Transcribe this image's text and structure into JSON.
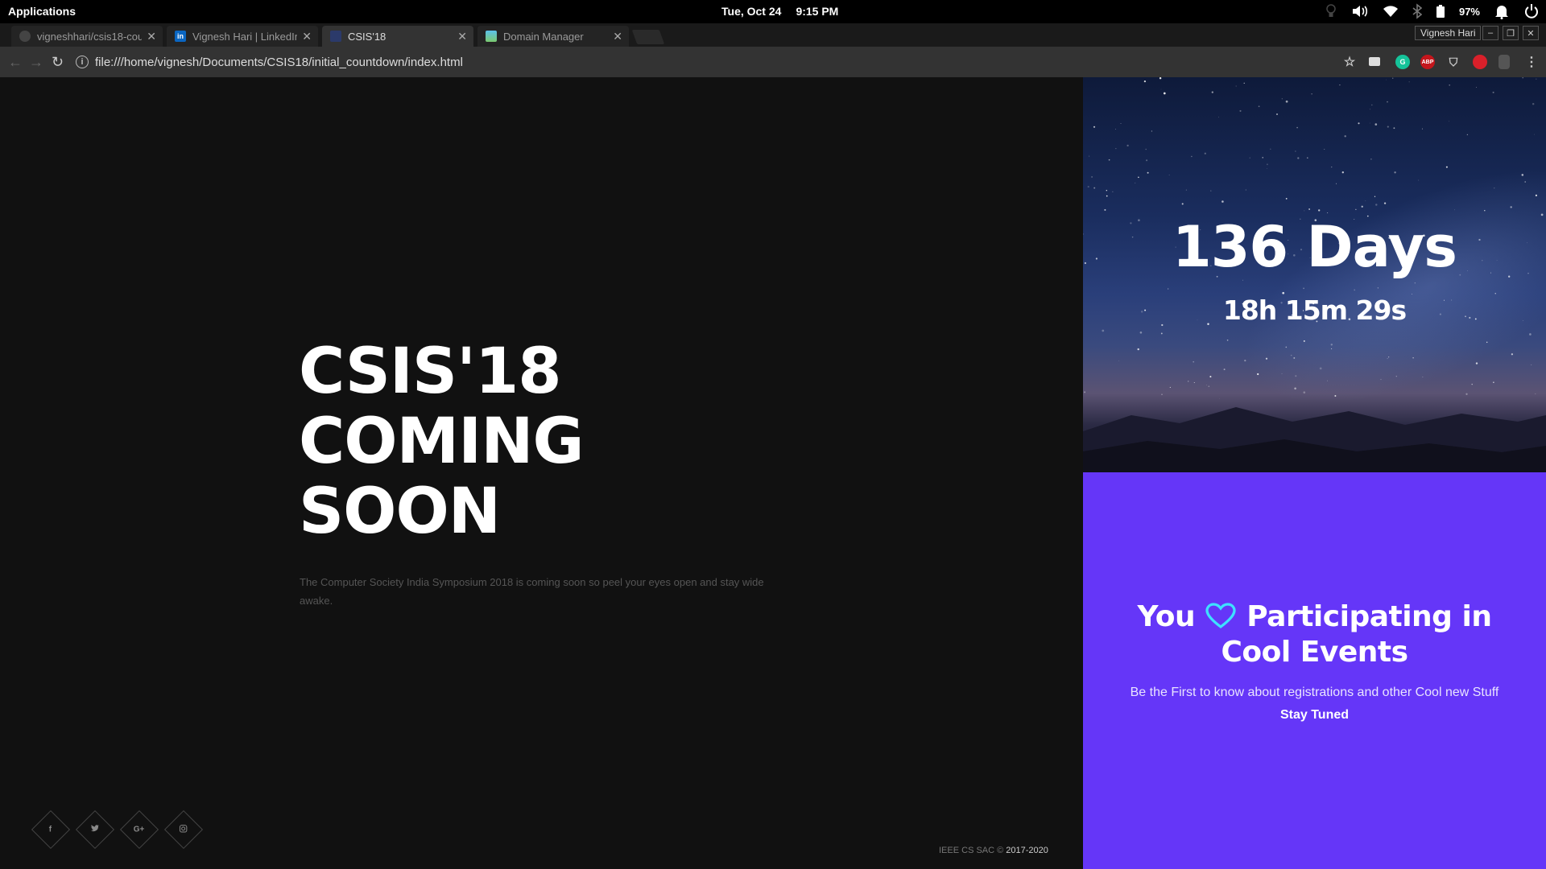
{
  "os": {
    "apps_label": "Applications",
    "date": "Tue, Oct 24",
    "time": "9:15 PM",
    "battery": "97%",
    "tray_icons": [
      "lightbulb-icon",
      "volume-icon",
      "wifi-icon",
      "bluetooth-icon",
      "battery-icon",
      "bell-icon",
      "power-icon"
    ]
  },
  "browser": {
    "tabs": [
      {
        "label": "vigneshhari/csis18-cou",
        "icon": "github-icon"
      },
      {
        "label": "Vignesh Hari | LinkedIn",
        "icon": "linkedin-icon"
      },
      {
        "label": "CSIS'18",
        "icon": "csis-icon"
      },
      {
        "label": "Domain Manager",
        "icon": "domain-manager-icon"
      }
    ],
    "active_tab": 2,
    "profile": "Vignesh Hari",
    "url": "file:///home/vignesh/Documents/CSIS18/initial_countdown/index.html",
    "extensions": [
      "cast-icon",
      "grammarly-icon",
      "adblock-icon",
      "shield-icon",
      "record-icon",
      "ghost-icon"
    ]
  },
  "hero": {
    "line1": "CSIS'18",
    "line2": "COMING",
    "line3": "SOON",
    "description": "The Computer Society India Symposium 2018 is coming soon so peel your eyes open and stay wide awake."
  },
  "social": [
    "f",
    "t",
    "G+",
    "ig"
  ],
  "footer": {
    "org": "IEEE CS SAC © ",
    "years": "2017-2020"
  },
  "countdown": {
    "days": "136 Days",
    "hms": "18h 15m 29s"
  },
  "promo": {
    "you": "You",
    "participating": "Participating in",
    "cool_events": "Cool Events",
    "subtitle": "Be the First to know about registrations and other Cool new Stuff",
    "stay_tuned": "Stay Tuned",
    "heart_color": "#3ee0ff"
  },
  "colors": {
    "accent_purple": "#6536f8"
  }
}
